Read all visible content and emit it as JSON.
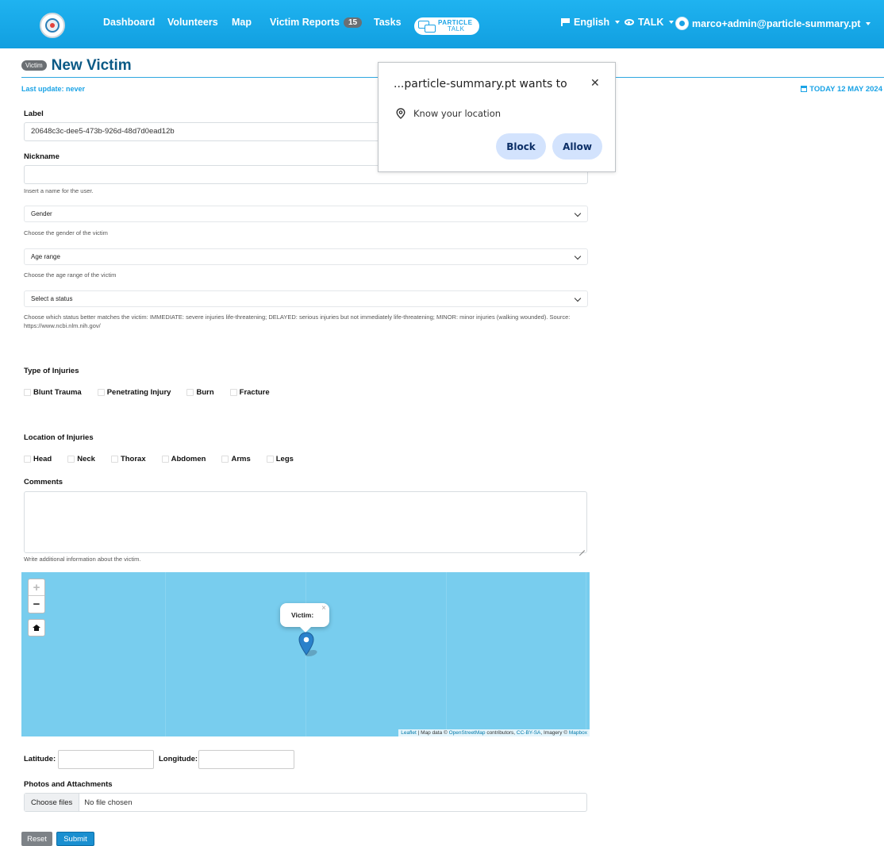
{
  "navbar": {
    "links": [
      "Dashboard",
      "Volunteers",
      "Map",
      "Victim Reports",
      "Tasks"
    ],
    "victim_reports_count": "15",
    "brand_logo_text": "PARTICLE",
    "brand_logo_subtext": "TALK",
    "language": "English",
    "talk_menu": "TALK",
    "user_email": "marco+admin@particle-summary.pt"
  },
  "header": {
    "tag": "Victim",
    "title": "New Victim",
    "last_update": "Last update: never",
    "today": "TODAY 12 MAY 2024"
  },
  "form": {
    "label_label": "Label",
    "label_value": "20648c3c-dee5-473b-926d-48d7d0ead12b",
    "nickname_label": "Nickname",
    "nickname_help": "Insert a name for the user.",
    "gender_value": "Gender",
    "gender_help": "Choose the gender of the victim",
    "age_value": "Age range",
    "age_help": "Choose the age range of the victim",
    "status_value": "Select a status",
    "status_help": "Choose which status better matches the victim: IMMEDIATE: severe injuries life-threatening; DELAYED: serious injuries but not immediately life-threatening; MINOR: minor injuries (walking wounded). Source: https://www.ncbi.nlm.nih.gov/",
    "injury_types_label": "Type of Injuries",
    "injury_types": [
      "Blunt Trauma",
      "Penetrating Injury",
      "Burn",
      "Fracture"
    ],
    "injury_locations_label": "Location of Injuries",
    "injury_locations": [
      "Head",
      "Neck",
      "Thorax",
      "Abdomen",
      "Arms",
      "Legs"
    ],
    "comments_label": "Comments",
    "comments_help": "Write additional information about the victim.",
    "latitude_label": "Latitude:",
    "longitude_label": "Longitude:",
    "attachments_label": "Photos and Attachments",
    "choose_files": "Choose files",
    "no_file": "No file chosen",
    "reset": "Reset",
    "submit": "Submit"
  },
  "map": {
    "zoom_in": "+",
    "zoom_out": "−",
    "popup_text": "Victim:",
    "popup_close": "×",
    "attribution_leaflet": "Leaflet",
    "attribution_mid": " | Map data © ",
    "attribution_osm": "OpenStreetMap",
    "attribution_contrib": " contributors, ",
    "attribution_license": "CC-BY-SA",
    "attribution_imagery": ", Imagery © ",
    "attribution_mapbox": "Mapbox",
    "water_color": "#78cdee",
    "marker_color": "#2a81cb"
  },
  "permission_dialog": {
    "title": "...particle-summary.pt wants to",
    "close": "✕",
    "request": "Know your location",
    "block": "Block",
    "allow": "Allow"
  }
}
